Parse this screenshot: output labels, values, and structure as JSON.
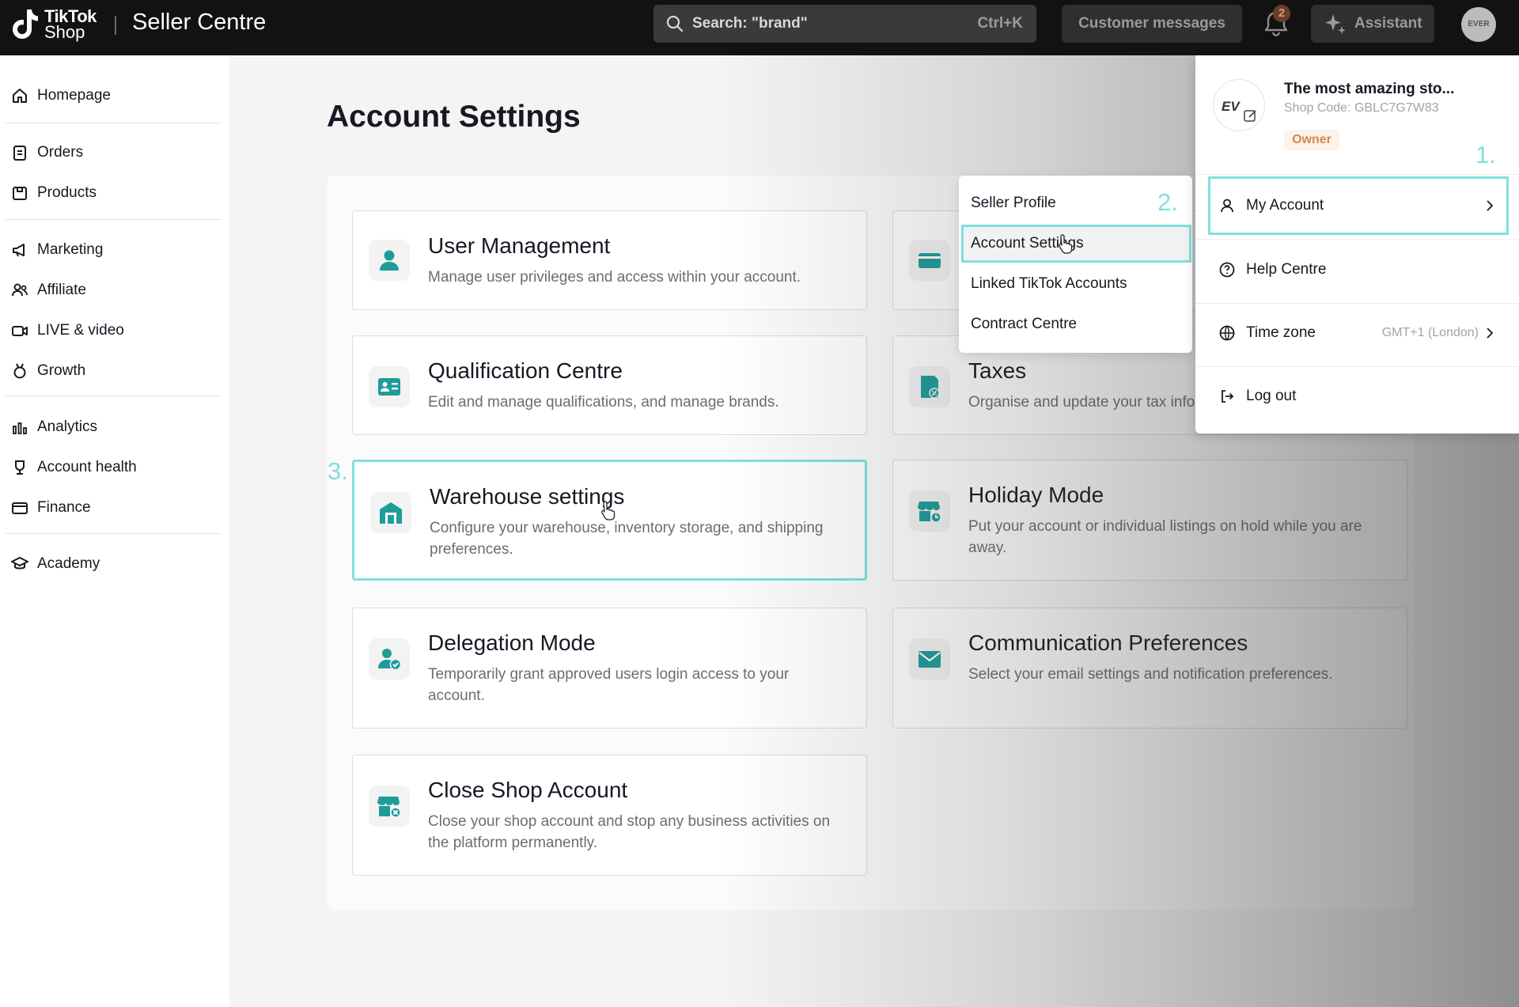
{
  "topbar": {
    "logo_line1": "TikTok",
    "logo_line2": "Shop",
    "title": "Seller Centre",
    "search_placeholder": "Search: \"brand\"",
    "search_shortcut": "Ctrl+K",
    "customer_messages": "Customer messages",
    "notification_count": "2",
    "assistant": "Assistant",
    "avatar_text": "EVER"
  },
  "sidebar": {
    "items": [
      {
        "label": "Homepage",
        "icon": "home-icon"
      },
      {
        "label": "Orders",
        "icon": "orders-icon"
      },
      {
        "label": "Products",
        "icon": "products-icon"
      },
      {
        "label": "Marketing",
        "icon": "megaphone-icon"
      },
      {
        "label": "Affiliate",
        "icon": "affiliate-icon"
      },
      {
        "label": "LIVE & video",
        "icon": "live-video-icon"
      },
      {
        "label": "Growth",
        "icon": "growth-medal-icon"
      },
      {
        "label": "Analytics",
        "icon": "analytics-icon"
      },
      {
        "label": "Account health",
        "icon": "trophy-icon"
      },
      {
        "label": "Finance",
        "icon": "finance-icon"
      },
      {
        "label": "Academy",
        "icon": "academy-cap-icon"
      }
    ]
  },
  "page": {
    "title": "Account Settings",
    "cards": [
      {
        "title": "User Management",
        "desc": "Manage user privileges and access within your account."
      },
      {
        "title": "Qualification Centre",
        "desc": "Edit and manage qualifications, and manage brands."
      },
      {
        "title": "Warehouse settings",
        "desc": "Configure your warehouse, inventory storage, and shipping preferences."
      },
      {
        "title": "Delegation Mode",
        "desc": "Temporarily grant approved users login access to your account."
      },
      {
        "title": "Close Shop Account",
        "desc": "Close your shop account and stop any business activities on the platform permanently."
      },
      {
        "title": "Taxes",
        "desc": "Organise and update your tax info"
      },
      {
        "title": "Holiday Mode",
        "desc": "Put your account or individual listings on hold while you are away."
      },
      {
        "title": "Communication Preferences",
        "desc": "Select your email settings and notification preferences."
      }
    ]
  },
  "submenu": {
    "items": [
      "Seller Profile",
      "Account Settings",
      "Linked TikTok Accounts",
      "Contract Centre"
    ]
  },
  "account": {
    "shop_logo_text": "EV",
    "shop_name": "The most amazing sto...",
    "shop_code": "Shop Code: GBLC7G7W83",
    "role": "Owner",
    "my_account": "My Account",
    "help_centre": "Help Centre",
    "time_zone": "Time zone",
    "time_zone_value": "GMT+1 (London)",
    "log_out": "Log out"
  },
  "annotations": {
    "step1": "1.",
    "step2": "2.",
    "step3": "3."
  },
  "colors": {
    "accent": "#7fe0dd",
    "teal_icon": "#1f9c9a",
    "topbar": "#121212"
  }
}
